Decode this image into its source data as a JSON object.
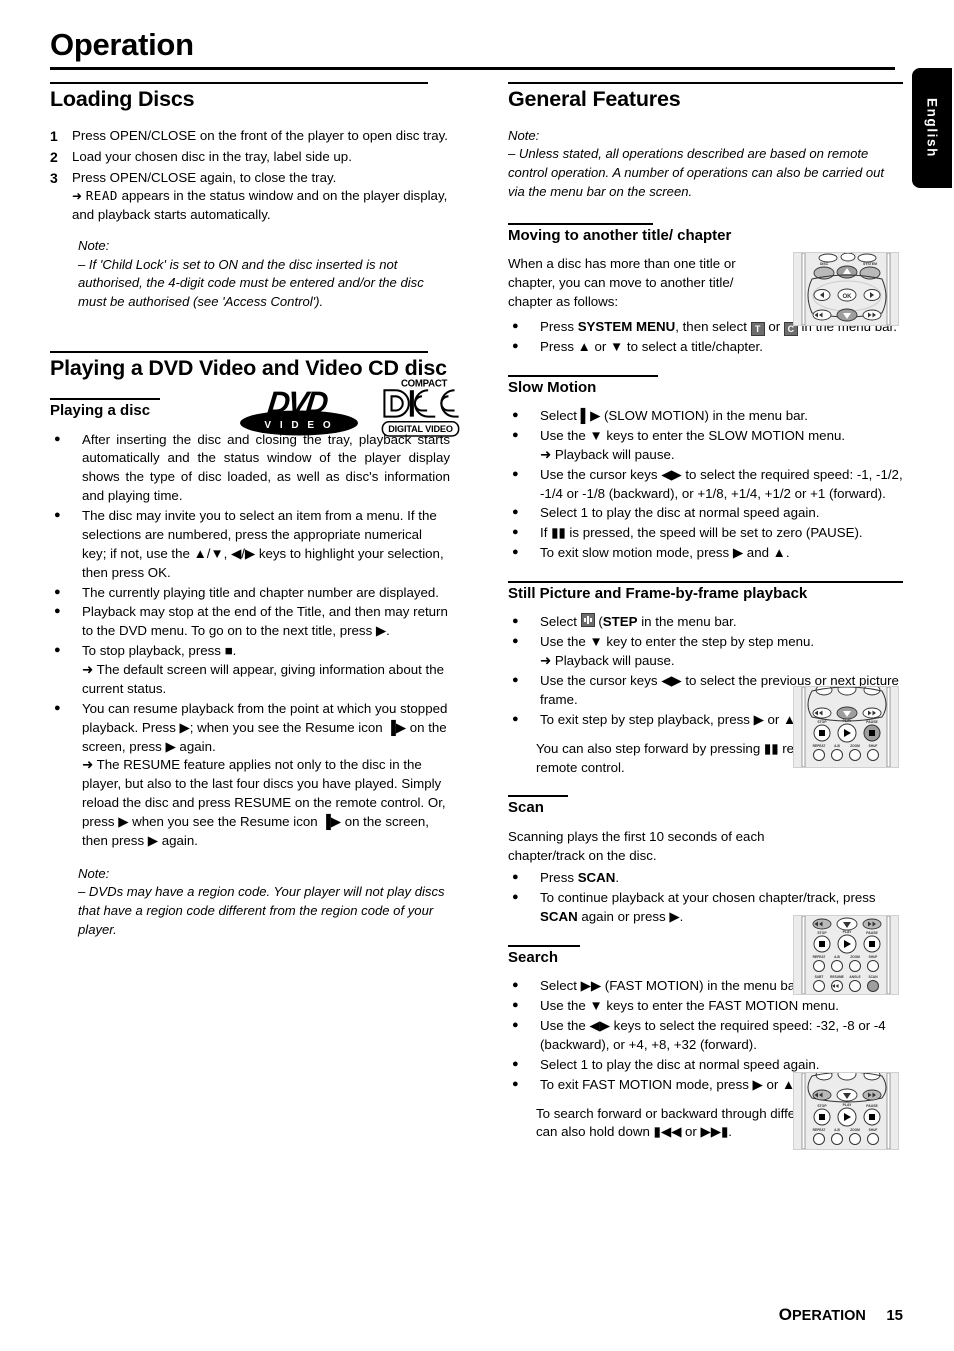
{
  "header": {
    "title": "Operation",
    "language_tab": "English"
  },
  "footer": {
    "section": "OPERATION",
    "section_cap": "O",
    "section_rest": "PERATION",
    "page_number": "15"
  },
  "left_column": {
    "loading_discs": {
      "heading": "Loading Discs",
      "steps": [
        {
          "num": "1",
          "text": "Press OPEN/CLOSE on the front of the player to open disc tray."
        },
        {
          "num": "2",
          "text": "Load your chosen disc in the tray, label side up."
        },
        {
          "num": "3",
          "text": "Press OPEN/CLOSE again, to close the tray."
        }
      ],
      "step3_result_lcd": "READ",
      "step3_result": "appears in the status window and on the player display, and playback starts automatically.",
      "note_label": "Note:",
      "note_text": "–  If 'Child Lock' is set to ON and the disc inserted is not authorised, the 4-digit code must be entered and/or the disc must be authorised (see 'Access Control')."
    },
    "playing_dvd": {
      "heading": "Playing a DVD Video and Video CD disc",
      "subheading": "Playing a disc",
      "logos": [
        {
          "name": "dvd-video-logo",
          "text": "DVD",
          "sub": "V I D E O"
        },
        {
          "name": "compact-disc-digital-video-logo",
          "top": "COMPACT",
          "mid": "disc",
          "bottom": "DIGITAL VIDEO"
        }
      ],
      "bullets": [
        "After inserting the disc and closing the tray, playback starts automatically and the status window of the player display shows the type of disc loaded, as well as disc's information and playing time.",
        "The disc may invite you to select an item from a menu. If the selections are numbered, press the appropriate numerical key; if not, use the ▲/▼, ◀/▶ keys to highlight your selection, then press OK.",
        "The currently playing title and chapter number are displayed.",
        "Playback may stop at the end of the Title, and then may return to the DVD menu. To go on to the next title, press ▶.",
        "To stop playback, press ■.",
        "You can resume playback from the point at which you stopped playback. Press ▶; when you see the Resume icon ▐▶ on the screen, press ▶ again."
      ],
      "result_stop": "➜ The default screen will appear, giving information about the current status.",
      "result_resume": "➜ The RESUME feature applies not only to the disc in the player, but also to the last four discs you have played. Simply reload the disc and press RESUME on the remote control. Or, press ▶ when you see the Resume icon ▐▶ on the screen, then press ▶ again.",
      "resume_bold": "RESUME",
      "note_label": "Note:",
      "note_text": "–  DVDs may have a region code. Your player will not play discs that have a region code different from the region code of your player."
    }
  },
  "right_column": {
    "general_features": {
      "heading": "General Features",
      "note_label": "Note:",
      "note_text": "–  Unless stated, all operations described are based on remote control operation.  A number of operations can also be carried out via the menu bar on the screen."
    },
    "moving_title": {
      "heading": "Moving to another title/ chapter",
      "intro": "When a disc has more than one title or chapter, you can move to another title/ chapter as follows:",
      "bullet1_pre": "Press ",
      "bullet1_bold": "SYSTEM MENU",
      "bullet1_mid": ", then select ",
      "icon_title": "T",
      "bullet1_or": " or ",
      "icon_chapter": "C",
      "bullet1_post": " in the menu bar.",
      "bullet2": "Press ▲ or ▼ to select a title/chapter."
    },
    "slow_motion": {
      "heading": "Slow Motion",
      "bullets": [
        "Select ▌▶ (SLOW MOTION) in the menu bar.",
        "Use the ▼ keys to enter the SLOW MOTION menu.",
        "➜ Playback will pause.",
        "Use the cursor keys ◀▶ to select the required speed: -1, -1/2, -1/4 or -1/8 (backward), or +1/8, +1/4, +1/2 or +1 (forward).",
        "Select 1 to play the disc at normal speed again.",
        "If ▮▮ is pressed, the speed will be set to zero (PAUSE).",
        "To exit slow motion mode, press ▶ and ▲."
      ]
    },
    "still_picture": {
      "heading": "Still Picture and Frame-by-frame playback",
      "bullet1_pre": "Select ",
      "bullet1_bold": "STEP",
      "bullet1_post": " in the menu bar.",
      "bullets": [
        "Use the ▼ key to enter the step by step menu.",
        "➜ Playback will pause.",
        "Use the cursor keys ◀▶ to select the previous or next picture frame.",
        "To exit step by step playback, press ▶ or ▲."
      ],
      "closing": "You can also step forward by pressing ▮▮ repeatedly on the remote control."
    },
    "scan": {
      "heading": "Scan",
      "intro": "Scanning plays the first 10 seconds of each chapter/track on the disc.",
      "bullet1_pre": "Press ",
      "bullet1_bold": "SCAN",
      "bullet1_post": ".",
      "bullet2_pre": "To continue playback at your chosen chapter/track, press ",
      "bullet2_bold": "SCAN",
      "bullet2_post": " again or press ▶."
    },
    "search": {
      "heading": "Search",
      "bullets": [
        "Select ▶▶ (FAST MOTION) in the menu bar.",
        "Use the ▼ keys to enter the FAST MOTION menu.",
        "Use the ◀▶ keys to select the required speed: -32, -8 or -4 (backward), or +4, +8, +32 (forward).",
        "Select 1 to play the disc at normal speed again.",
        "To exit FAST MOTION mode, press ▶ or ▲."
      ],
      "closing": "To search forward or backward through different speeds, you can also hold down ▮◀◀ or ▶▶▮."
    }
  }
}
